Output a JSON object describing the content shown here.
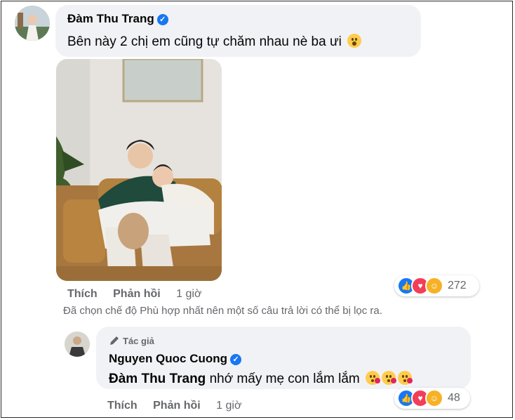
{
  "comment1": {
    "author": "Đàm Thu Trang",
    "text": "Bên này 2 chị em cũng tự chăm nhau nè ba ưi",
    "text_emoji": "face-with-open-mouth-emoji",
    "actions": {
      "like": "Thích",
      "reply": "Phản hồi",
      "time": "1 giờ"
    },
    "reactions": {
      "icons": [
        "like-icon",
        "love-icon",
        "care-icon"
      ],
      "count": "272"
    }
  },
  "filter_notice": "Đã chọn chế độ Phù hợp nhất nên một số câu trả lời có thể bị lọc ra.",
  "reply1": {
    "author_badge": "Tác giả",
    "author": "Nguyen Quoc Cuong",
    "mention": "Đàm Thu Trang",
    "text": "nhớ mấy mẹ con lắm lắm",
    "emojis": [
      "kissing-face-emoji",
      "kissing-face-emoji",
      "kissing-face-emoji"
    ],
    "actions": {
      "like": "Thích",
      "reply": "Phản hồi",
      "time": "1 giờ"
    },
    "reactions": {
      "icons": [
        "like-icon",
        "love-icon",
        "care-icon"
      ],
      "count": "48"
    }
  },
  "colors": {
    "bubble": "#f0f2f5",
    "verified": "#1877f2",
    "like": "#1877f2",
    "love": "#f33e58",
    "care": "#f7b125",
    "secondary_text": "#65676b"
  }
}
